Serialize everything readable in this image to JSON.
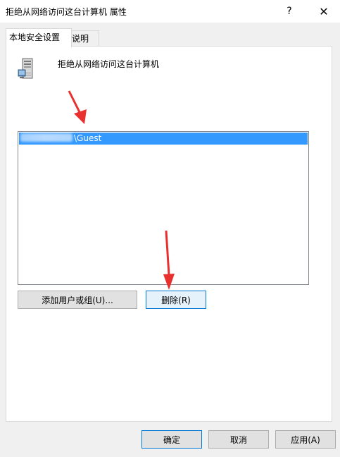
{
  "window": {
    "title": "拒绝从网络访问这台计算机 属性",
    "help_label": "?",
    "close_label": "✕"
  },
  "tabs": [
    {
      "label": "本地安全设置",
      "active": true
    },
    {
      "label": "说明",
      "active": false
    }
  ],
  "policy": {
    "icon": "server-computer-icon",
    "title": "拒绝从网络访问这台计算机"
  },
  "list": {
    "items": [
      {
        "suffix": "\\Guest",
        "selected": true,
        "prefix_obscured": true
      }
    ]
  },
  "buttons": {
    "add": "添加用户或组(U)...",
    "remove": "删除(R)",
    "ok": "确定",
    "cancel": "取消",
    "apply": "应用(A)"
  },
  "annotations": {
    "arrow_color": "#e8312f"
  },
  "colors": {
    "selection": "#3399ff",
    "focus_border": "#0078d7"
  }
}
